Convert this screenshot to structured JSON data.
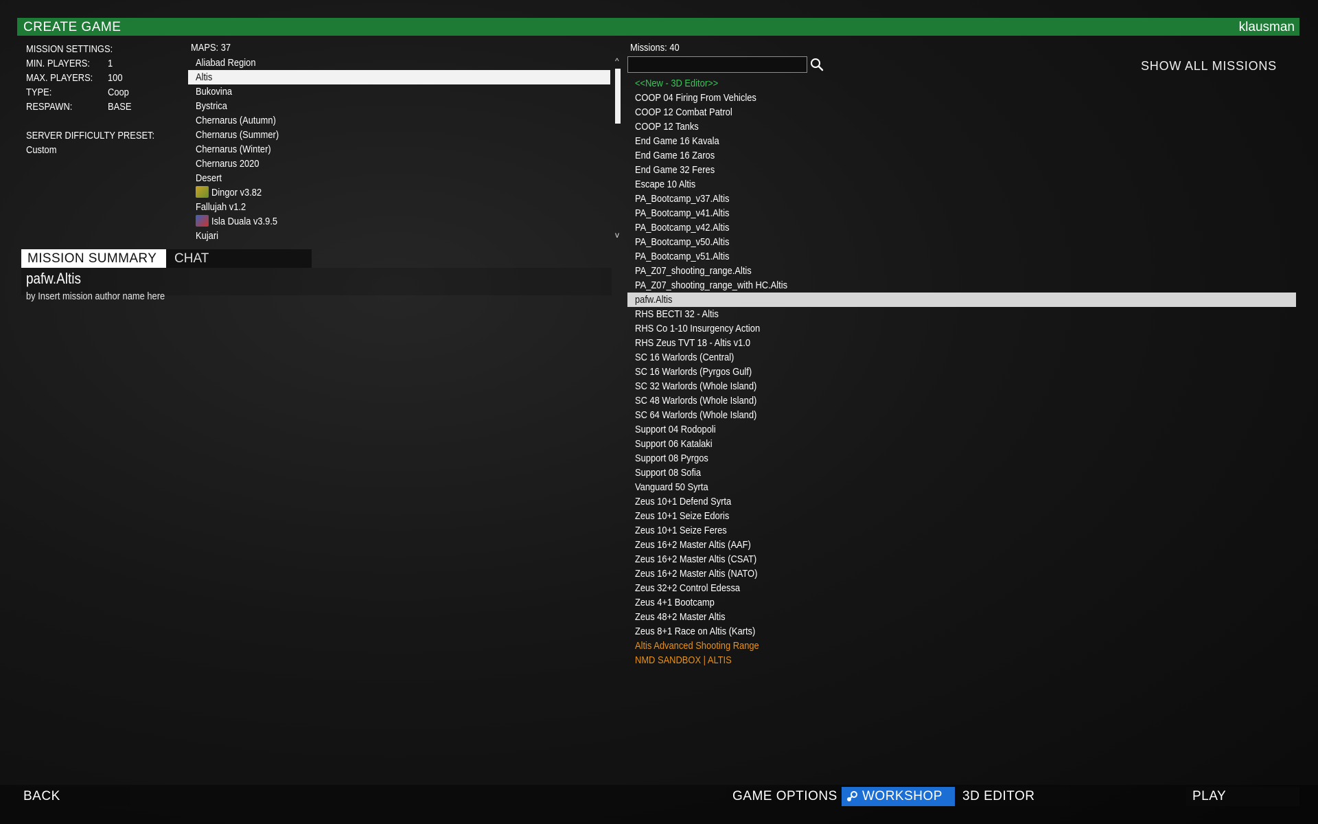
{
  "header": {
    "title": "CREATE GAME",
    "user": "klausman",
    "color": "#1e7b36"
  },
  "settings": {
    "heading": "MISSION SETTINGS:",
    "min_players_label": "MIN. PLAYERS:",
    "min_players": "1",
    "max_players_label": "MAX. PLAYERS:",
    "max_players": "100",
    "type_label": "TYPE:",
    "type": "Coop",
    "respawn_label": "RESPAWN:",
    "respawn": "BASE",
    "difficulty_label": "SERVER DIFFICULTY PRESET:",
    "difficulty": "Custom"
  },
  "maps": {
    "count_label": "MAPS: 37",
    "selected": "Altis",
    "items": [
      {
        "label": "Aliabad Region"
      },
      {
        "label": "Altis"
      },
      {
        "label": "Bukovina"
      },
      {
        "label": "Bystrica"
      },
      {
        "label": "Chernarus (Autumn)"
      },
      {
        "label": "Chernarus (Summer)"
      },
      {
        "label": "Chernarus (Winter)"
      },
      {
        "label": "Chernarus 2020"
      },
      {
        "label": "Desert"
      },
      {
        "label": "Dingor v3.82",
        "icon": "mod-icon-dingor"
      },
      {
        "label": "Fallujah v1.2"
      },
      {
        "label": "Isla Duala v3.9.5",
        "icon": "mod-icon-isla-duala"
      },
      {
        "label": "Kujari"
      }
    ]
  },
  "tabs": {
    "summary": "MISSION SUMMARY",
    "chat": "CHAT"
  },
  "summary": {
    "title": "pafw.Altis",
    "author": "by Insert mission author name here"
  },
  "missions": {
    "count_label": "Missions: 40",
    "search_placeholder": "",
    "show_all": "SHOW ALL MISSIONS",
    "selected": "pafw.Altis",
    "colors": {
      "new": "#3cc35a",
      "workshop": "#e8921c",
      "default": "#ffffff"
    },
    "items": [
      {
        "label": "<<New - 3D Editor>>",
        "kind": "new"
      },
      {
        "label": "COOP 04 Firing From Vehicles"
      },
      {
        "label": "COOP 12 Combat Patrol"
      },
      {
        "label": "COOP 12 Tanks"
      },
      {
        "label": "End Game 16 Kavala"
      },
      {
        "label": "End Game 16 Zaros"
      },
      {
        "label": "End Game 32 Feres"
      },
      {
        "label": "Escape 10 Altis"
      },
      {
        "label": "PA_Bootcamp_v37.Altis"
      },
      {
        "label": "PA_Bootcamp_v41.Altis"
      },
      {
        "label": "PA_Bootcamp_v42.Altis"
      },
      {
        "label": "PA_Bootcamp_v50.Altis"
      },
      {
        "label": "PA_Bootcamp_v51.Altis"
      },
      {
        "label": "PA_Z07_shooting_range.Altis"
      },
      {
        "label": "PA_Z07_shooting_range_with HC.Altis"
      },
      {
        "label": "pafw.Altis"
      },
      {
        "label": "RHS BECTI 32 - Altis"
      },
      {
        "label": "RHS Co 1-10 Insurgency Action"
      },
      {
        "label": "RHS Zeus TVT 18 - Altis v1.0"
      },
      {
        "label": "SC 16 Warlords (Central)"
      },
      {
        "label": "SC 16 Warlords (Pyrgos Gulf)"
      },
      {
        "label": "SC 32 Warlords (Whole Island)"
      },
      {
        "label": "SC 48 Warlords (Whole Island)"
      },
      {
        "label": "SC 64 Warlords (Whole Island)"
      },
      {
        "label": "Support 04 Rodopoli"
      },
      {
        "label": "Support 06 Katalaki"
      },
      {
        "label": "Support 08 Pyrgos"
      },
      {
        "label": "Support 08 Sofia"
      },
      {
        "label": "Vanguard 50 Syrta"
      },
      {
        "label": "Zeus 10+1 Defend Syrta"
      },
      {
        "label": "Zeus 10+1 Seize Edoris"
      },
      {
        "label": "Zeus 10+1 Seize Feres"
      },
      {
        "label": "Zeus 16+2 Master Altis (AAF)"
      },
      {
        "label": "Zeus 16+2 Master Altis (CSAT)"
      },
      {
        "label": "Zeus 16+2 Master Altis (NATO)"
      },
      {
        "label": "Zeus 32+2 Control Edessa"
      },
      {
        "label": "Zeus 4+1 Bootcamp"
      },
      {
        "label": "Zeus 48+2 Master Altis"
      },
      {
        "label": "Zeus 8+1 Race on Altis (Karts)"
      },
      {
        "label": "Altis Advanced Shooting Range",
        "kind": "workshop"
      },
      {
        "label": "NMD SANDBOX | ALTIS",
        "kind": "workshop"
      }
    ]
  },
  "bottom": {
    "back": "BACK",
    "game_options": "GAME OPTIONS",
    "workshop": "WORKSHOP",
    "workshop_color": "#1a6ed4",
    "editor": "3D EDITOR",
    "play": "PLAY"
  }
}
